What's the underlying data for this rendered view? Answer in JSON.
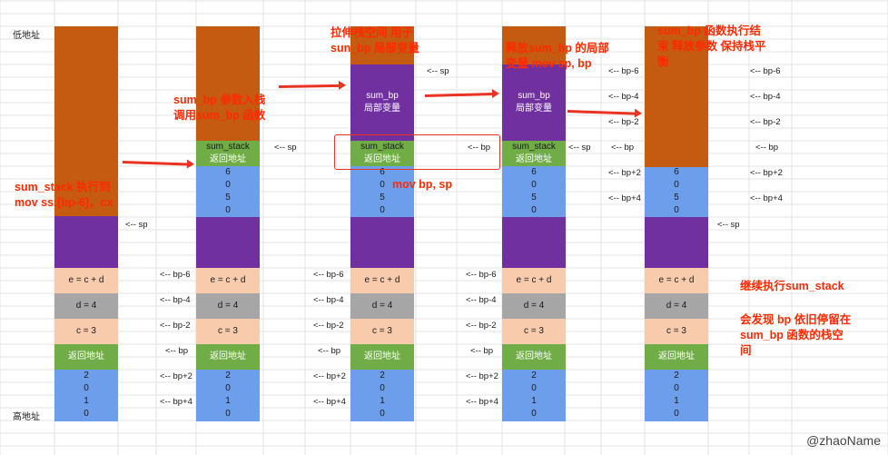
{
  "addresses": {
    "low": "低地址",
    "high": "高地址"
  },
  "cells": {
    "sum_bp": "sum_bp",
    "locals": "局部变量",
    "sum_stack": "sum_stack",
    "ret": "返回地址",
    "e": "e = c + d",
    "d": "d = 4",
    "c": "c = 3",
    "v6": "6",
    "v0": "0",
    "v5": "5",
    "v2": "2",
    "v1": "1"
  },
  "pointers": {
    "sp": "<-- sp",
    "bp": "<-- bp",
    "bp_m6": "<-- bp-6",
    "bp_m4": "<-- bp-4",
    "bp_m2": "<-- bp-2",
    "bp_p2": "<-- bp+2",
    "bp_p4": "<-- bp+4"
  },
  "annotations": {
    "a1_l1": "sum_stack 执行到",
    "a1_l2": "mov ss:[bp-6]，cx",
    "a2_l1": "sum_bp 参数入栈",
    "a2_l2": "调用sum_bp 函数",
    "a3_l1": "拉伸栈空间 用于",
    "a3_l2": "sun_bp 局部变量",
    "a4": "mov  bp,  sp",
    "a5_l1": "释放sum_bp 的局部",
    "a5_l2": "变量  mov  sp,  bp",
    "a6_l1": "sum_bp 函数执行结",
    "a6_l2": "束  释放参数 保持栈平",
    "a6_l3": "衡",
    "a7": "继续执行sum_stack",
    "a8_l1": "会发现 bp 依旧停留在",
    "a8_l2": "sum_bp 函数的栈空",
    "a8_l3": "间"
  },
  "colors": {
    "orange": "#c55a11",
    "purple": "#7030a0",
    "peach": "#f8cbad",
    "gray": "#a6a6a6",
    "green": "#70ad47",
    "blue": "#6d9eeb",
    "annotation_red": "#ff2a00"
  },
  "watermark": "@zhaoName"
}
